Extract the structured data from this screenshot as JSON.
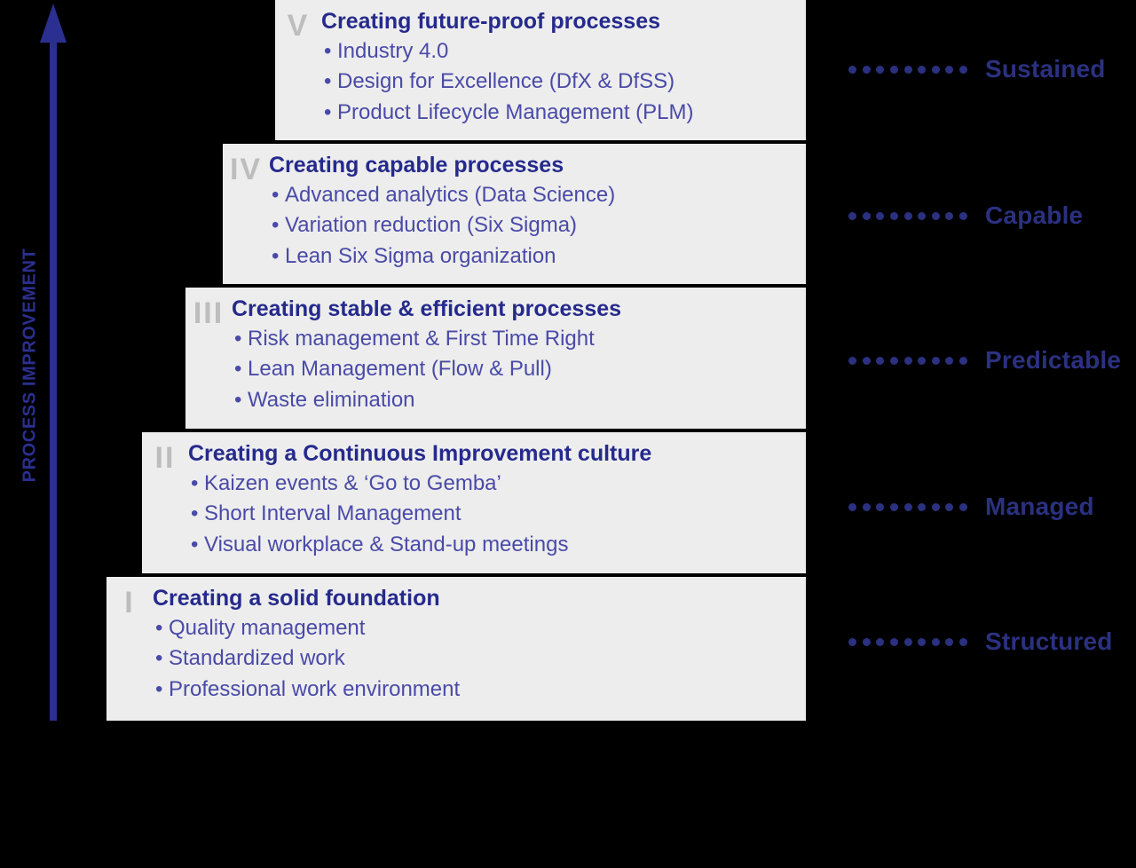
{
  "axis": {
    "label": "PROCESS IMPROVEMENT",
    "arrow_direction": "up",
    "color": "#2b2f8f"
  },
  "colors": {
    "background": "#000000",
    "step_fill": "#ededed",
    "heading_text": "#252a8c",
    "bullet_text": "#4a4aa8",
    "numeral": "#bdbdbd",
    "maturity_text": "#2b3180",
    "dot": "#2b3180"
  },
  "steps": [
    {
      "numeral": "V",
      "title": "Creating future-proof processes",
      "bullets": [
        "Industry 4.0",
        "Design for Excellence (DfX & DfSS)",
        "Product Lifecycle Management (PLM)"
      ]
    },
    {
      "numeral": "IV",
      "title": "Creating capable processes",
      "bullets": [
        "Advanced analytics (Data Science)",
        "Variation reduction (Six Sigma)",
        "Lean Six Sigma organization"
      ]
    },
    {
      "numeral": "III",
      "title": "Creating stable & efficient processes",
      "bullets": [
        "Risk management & First Time Right",
        "Lean Management (Flow & Pull)",
        "Waste elimination"
      ]
    },
    {
      "numeral": "II",
      "title": "Creating a Continuous Improvement culture",
      "bullets": [
        "Kaizen events & ‘Go to Gemba’",
        "Short Interval Management",
        "Visual workplace & Stand-up meetings"
      ]
    },
    {
      "numeral": "I",
      "title": "Creating a solid foundation",
      "bullets": [
        "Quality management",
        "Standardized work",
        "Professional work environment"
      ]
    }
  ],
  "maturity_levels": [
    {
      "label": "Sustained",
      "dots": 9
    },
    {
      "label": "Capable",
      "dots": 9
    },
    {
      "label": "Predictable",
      "dots": 9
    },
    {
      "label": "Managed",
      "dots": 9
    },
    {
      "label": "Structured",
      "dots": 9
    }
  ]
}
